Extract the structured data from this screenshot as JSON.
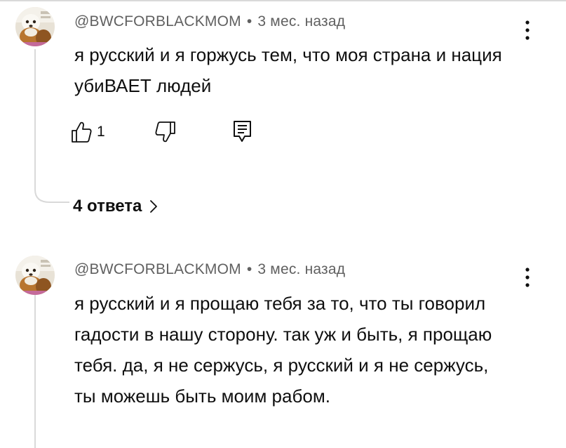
{
  "comments": [
    {
      "author": "@BWCFORBLACKMOM",
      "separator": "•",
      "time": "3 мес. назад",
      "text": "я русский и я горжусь тем, что моя страна и нация убиВАЕТ людей",
      "likes": "1",
      "replies_label": "4 ответа"
    },
    {
      "author": "@BWCFORBLACKMOM",
      "separator": "•",
      "time": "3 мес. назад",
      "text": "я русский и я прощаю тебя за то, что ты говорил гадости в нашу сторону. так уж и быть, я прощаю тебя. да, я не сержусь, я русский и я не сержусь, ты можешь быть моим рабом."
    }
  ],
  "icons": {
    "like": "thumb-up-icon",
    "dislike": "thumb-down-icon",
    "reply": "reply-icon",
    "more": "more-vertical-icon",
    "chevron": "chevron-right-icon"
  },
  "colors": {
    "text": "#0f0f0f",
    "meta": "#606060",
    "thread": "#d9d9d9"
  }
}
